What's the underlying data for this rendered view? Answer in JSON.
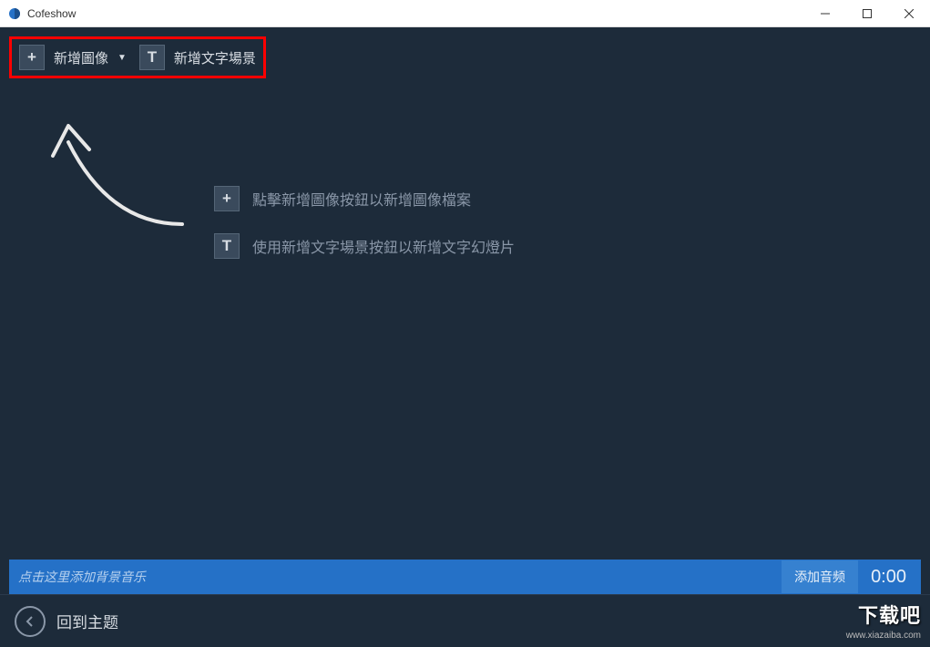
{
  "titlebar": {
    "title": "Cofeshow"
  },
  "toolbar": {
    "add_image_label": "新增圖像",
    "add_text_scene_label": "新增文字場景"
  },
  "hints": {
    "image_hint": "點擊新增圖像按鈕以新增圖像檔案",
    "text_hint": "使用新增文字場景按鈕以新增文字幻燈片"
  },
  "audio": {
    "placeholder": "点击这里添加背景音乐",
    "add_button": "添加音频",
    "time": "0:00"
  },
  "footer": {
    "back_label": "回到主题"
  },
  "watermark": {
    "main": "下载吧",
    "url": "www.xiazaiba.com"
  }
}
